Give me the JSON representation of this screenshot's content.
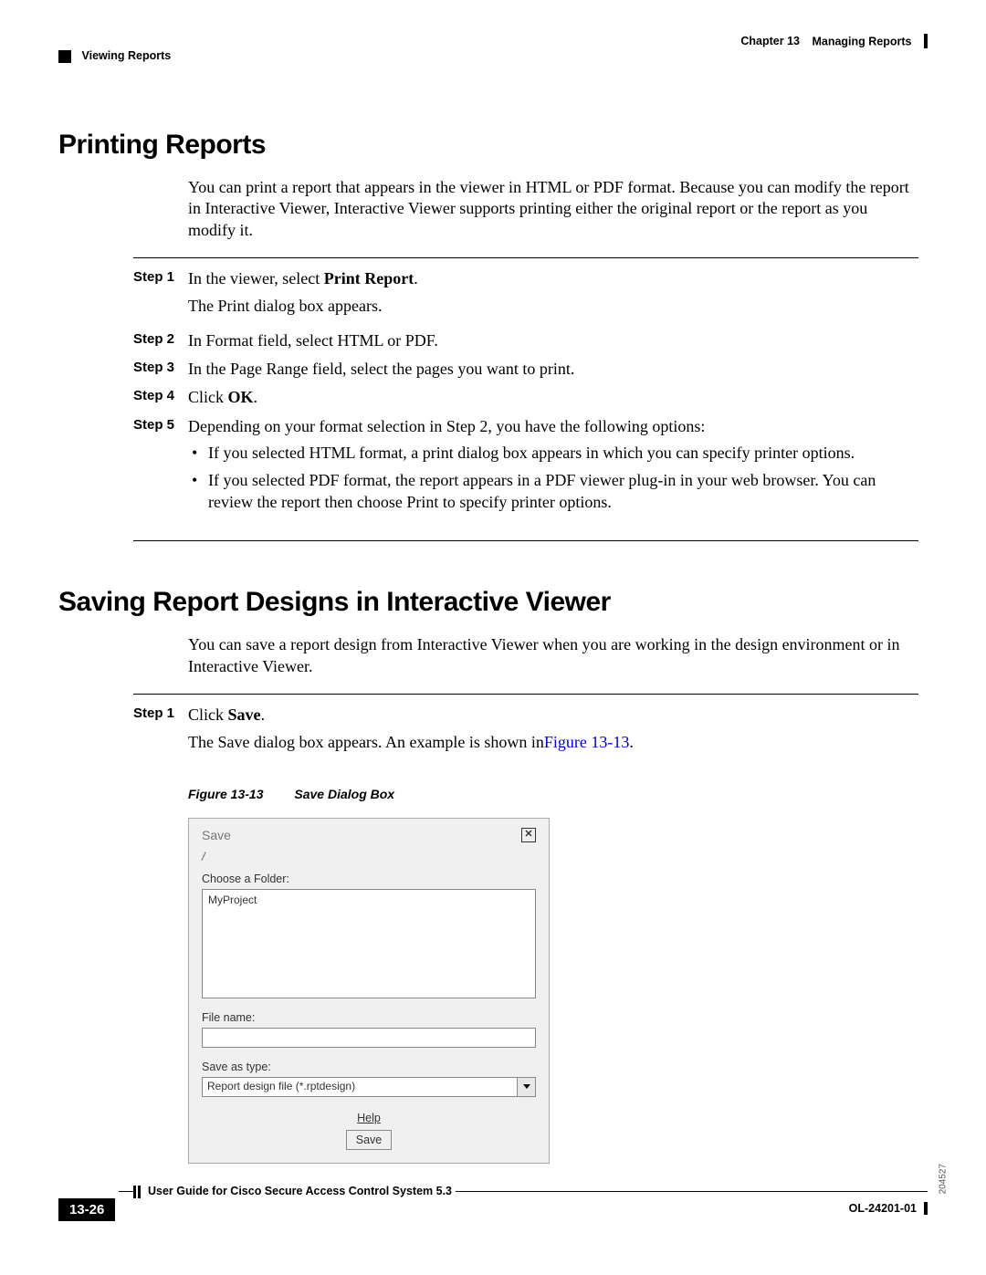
{
  "header": {
    "chapter": "Chapter 13",
    "title": "Managing Reports",
    "section": "Viewing Reports"
  },
  "sections": [
    {
      "heading": "Printing Reports",
      "intro": "You can print a report that appears in the viewer in HTML or PDF format. Because you can modify the report in Interactive Viewer, Interactive Viewer supports printing either the original report or the report as you modify it.",
      "steps": {
        "s1_a": "In the viewer, select ",
        "s1_bold": "Print Report",
        "s1_b": ".",
        "s1_line2": "The Print dialog box appears.",
        "s2": "In Format field, select HTML or PDF.",
        "s3": "In the Page Range field, select the pages you want to print.",
        "s4_a": "Click ",
        "s4_bold": "OK",
        "s4_b": ".",
        "s5_intro": "Depending on your format selection in Step 2, you have the following options:",
        "s5_b1": "If you selected HTML format, a print dialog box appears in which you can specify printer options.",
        "s5_b2": "If you selected PDF format, the report appears in a PDF viewer plug-in in your web browser. You can review the report then choose Print to specify printer options."
      },
      "step_labels": [
        "Step 1",
        "Step 2",
        "Step 3",
        "Step 4",
        "Step 5"
      ]
    },
    {
      "heading": "Saving Report Designs in Interactive Viewer",
      "intro": "You can save a report design from Interactive Viewer when you are working in the design environment or in Interactive Viewer.",
      "steps": {
        "s1_label": "Step 1",
        "s1_a": "Click ",
        "s1_bold": "Save",
        "s1_b": ".",
        "s1_line2_a": "The Save dialog box appears. An example is shown in",
        "s1_line2_link": "Figure 13-13",
        "s1_line2_b": "."
      }
    }
  ],
  "figure": {
    "number": "Figure 13-13",
    "caption": "Save Dialog Box",
    "dialog": {
      "title": "Save",
      "slash": "/",
      "folder_label": "Choose a Folder:",
      "folder_item": "MyProject",
      "filename_label": "File name:",
      "saveas_label": "Save as type:",
      "saveas_value": "Report design file (*.rptdesign)",
      "help": "Help",
      "save_btn": "Save",
      "sidecode": "204527"
    }
  },
  "footer": {
    "title": "User Guide for Cisco Secure Access Control System 5.3",
    "page": "13-26",
    "docnum": "OL-24201-01"
  }
}
